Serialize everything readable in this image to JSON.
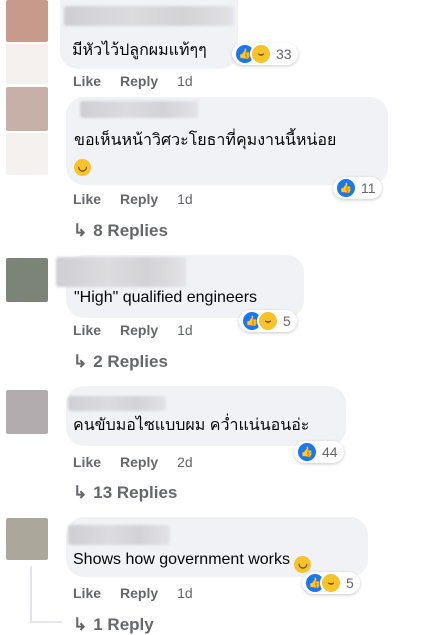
{
  "comments": [
    {
      "text": "มีหัวไว้ปลูกผมแท้ๆๆ",
      "reaction_count": "33",
      "reaction_types": [
        "like-icon",
        "haha-icon"
      ],
      "like_label": "Like",
      "reply_label": "Reply",
      "time": "1d",
      "avatar_color": "#c79a8c"
    },
    {
      "text": "ขอเห็นหน้าวิศวะโยธาที่คุมงานนี้หน่อย",
      "reaction_count": "11",
      "reaction_types": [
        "like-icon"
      ],
      "like_label": "Like",
      "reply_label": "Reply",
      "time": "1d",
      "replies_label": "8 Replies",
      "avatar_color": "#c7b0a8"
    },
    {
      "text": "\"High\" qualified engineers",
      "reaction_count": "5",
      "reaction_types": [
        "like-icon",
        "haha-icon"
      ],
      "like_label": "Like",
      "reply_label": "Reply",
      "time": "1d",
      "replies_label": "2 Replies",
      "avatar_color": "#7c8478"
    },
    {
      "text": "คนขับมอไซแบบผม คว่ำแน่นอนอ่ะ",
      "reaction_count": "44",
      "reaction_types": [
        "like-icon"
      ],
      "like_label": "Like",
      "reply_label": "Reply",
      "time": "2d",
      "replies_label": "13 Replies",
      "avatar_color": "#b3acae"
    },
    {
      "text": "Shows how government works",
      "reaction_count": "5",
      "reaction_types": [
        "like-icon",
        "haha-icon"
      ],
      "like_label": "Like",
      "reply_label": "Reply",
      "time": "1d",
      "replies_label": "1 Reply",
      "avatar_color": "#aca79b"
    }
  ],
  "icons": {
    "like": "like-icon",
    "haha": "haha-icon",
    "reply_arrow": "reply-arrow-icon",
    "emoji_grin": "grinning-emoji-icon"
  },
  "colors": {
    "bubble": "#f0f2f5",
    "meta_text": "#65676b",
    "like_blue": "#1877f2",
    "haha_yellow": "#f7c22a"
  }
}
